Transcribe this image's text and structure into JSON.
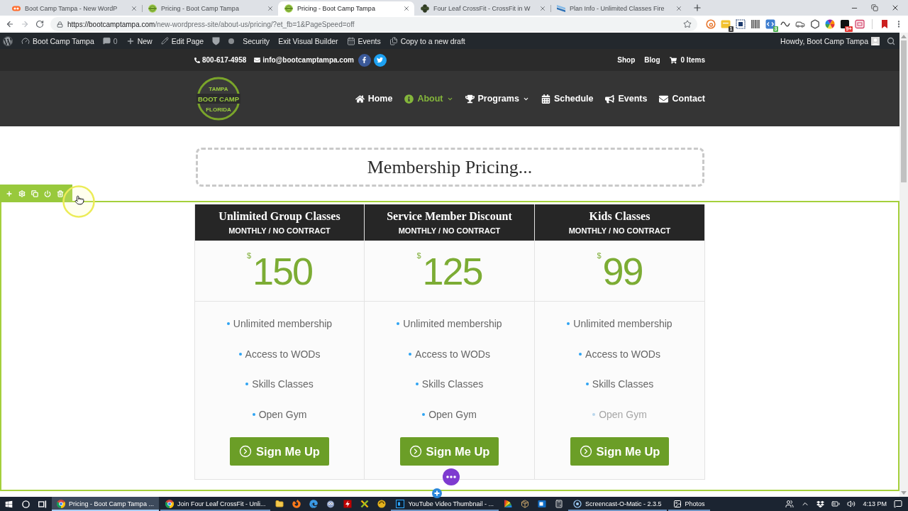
{
  "browser": {
    "tabs": [
      {
        "title": "Boot Camp Tampa - New WordP",
        "selected": false
      },
      {
        "title": "Pricing - Boot Camp Tampa",
        "selected": false
      },
      {
        "title": "Pricing - Boot Camp Tampa",
        "selected": true
      },
      {
        "title": "Four Leaf CrossFit - CrossFit in W",
        "selected": false
      },
      {
        "title": "Plan Info - Unlimited Classes Fire",
        "selected": false
      }
    ],
    "address": {
      "host": "https://bootcamptampa.com",
      "path": "/new-wordpress-site/about-us/pricing/?et_fb=1&PageSpeed=off"
    },
    "extension_badges": [
      "1",
      "3",
      "9+"
    ]
  },
  "admin_bar": {
    "site_name": "Boot Camp Tampa",
    "comment_count": "0",
    "new_label": "New",
    "edit_label": "Edit Page",
    "security_label": "Security",
    "exit_builder_label": "Exit Visual Builder",
    "events_label": "Events",
    "copy_label": "Copy to a new draft",
    "greeting": "Howdy, Boot Camp Tampa"
  },
  "site_header": {
    "phone": "800-617-4958",
    "email": "info@bootcamptampa.com",
    "links": [
      "Shop",
      "Blog"
    ],
    "cart": "0 Items",
    "logo": {
      "top": "TAMPA",
      "main": "BOOT CAMP",
      "bottom": "FLORIDA"
    },
    "nav": [
      {
        "label": "Home",
        "selected": false,
        "dropdown": false
      },
      {
        "label": "About",
        "selected": true,
        "dropdown": true
      },
      {
        "label": "Programs",
        "selected": false,
        "dropdown": true
      },
      {
        "label": "Schedule",
        "selected": false,
        "dropdown": false
      },
      {
        "label": "Events",
        "selected": false,
        "dropdown": false
      },
      {
        "label": "Contact",
        "selected": false,
        "dropdown": false
      }
    ]
  },
  "content": {
    "heading": "Membership Pricing...",
    "pricing_tables": [
      {
        "title": "Unlimited Group Classes",
        "subtitle": "MONTHLY / NO CONTRACT",
        "currency": "$",
        "price": "150",
        "features": [
          {
            "text": "Unlimited membership",
            "included": true
          },
          {
            "text": "Access to WODs",
            "included": true
          },
          {
            "text": "Skills Classes",
            "included": true
          },
          {
            "text": "Open Gym",
            "included": true
          }
        ],
        "button": "Sign Me Up"
      },
      {
        "title": "Service Member Discount",
        "subtitle": "MONTHLY / NO CONTRACT",
        "currency": "$",
        "price": "125",
        "features": [
          {
            "text": "Unlimited membership",
            "included": true
          },
          {
            "text": "Access to WODs",
            "included": true
          },
          {
            "text": "Skills Classes",
            "included": true
          },
          {
            "text": "Open Gym",
            "included": true
          }
        ],
        "button": "Sign Me Up"
      },
      {
        "title": "Kids Classes",
        "subtitle": "MONTHLY / NO CONTRACT",
        "currency": "$",
        "price": "99",
        "features": [
          {
            "text": "Unlimited membership",
            "included": true
          },
          {
            "text": "Access to WODs",
            "included": true
          },
          {
            "text": "Skills Classes",
            "included": true
          },
          {
            "text": "Open Gym",
            "included": false
          }
        ],
        "button": "Sign Me Up"
      }
    ]
  },
  "taskbar": {
    "items": [
      {
        "kind": "window",
        "label": "Pricing - Boot Camp Tampa ...",
        "selected": true
      },
      {
        "kind": "window",
        "label": "Join Four Leaf CrossFit - Unli...",
        "selected": false
      },
      {
        "kind": "pinned"
      },
      {
        "kind": "pinned"
      },
      {
        "kind": "pinned"
      },
      {
        "kind": "pinned"
      },
      {
        "kind": "pinned"
      },
      {
        "kind": "pinned"
      },
      {
        "kind": "pinned"
      },
      {
        "kind": "window",
        "label": "YouTube Video Thumbnail - ...",
        "selected": false
      },
      {
        "kind": "pinned"
      },
      {
        "kind": "pinned"
      },
      {
        "kind": "pinned"
      },
      {
        "kind": "pinned"
      },
      {
        "kind": "window",
        "label": "Screencast-O-Matic - 2.3.5",
        "selected": false
      },
      {
        "kind": "window",
        "label": "Photos",
        "selected": false
      }
    ],
    "time": "4:13 PM"
  }
}
